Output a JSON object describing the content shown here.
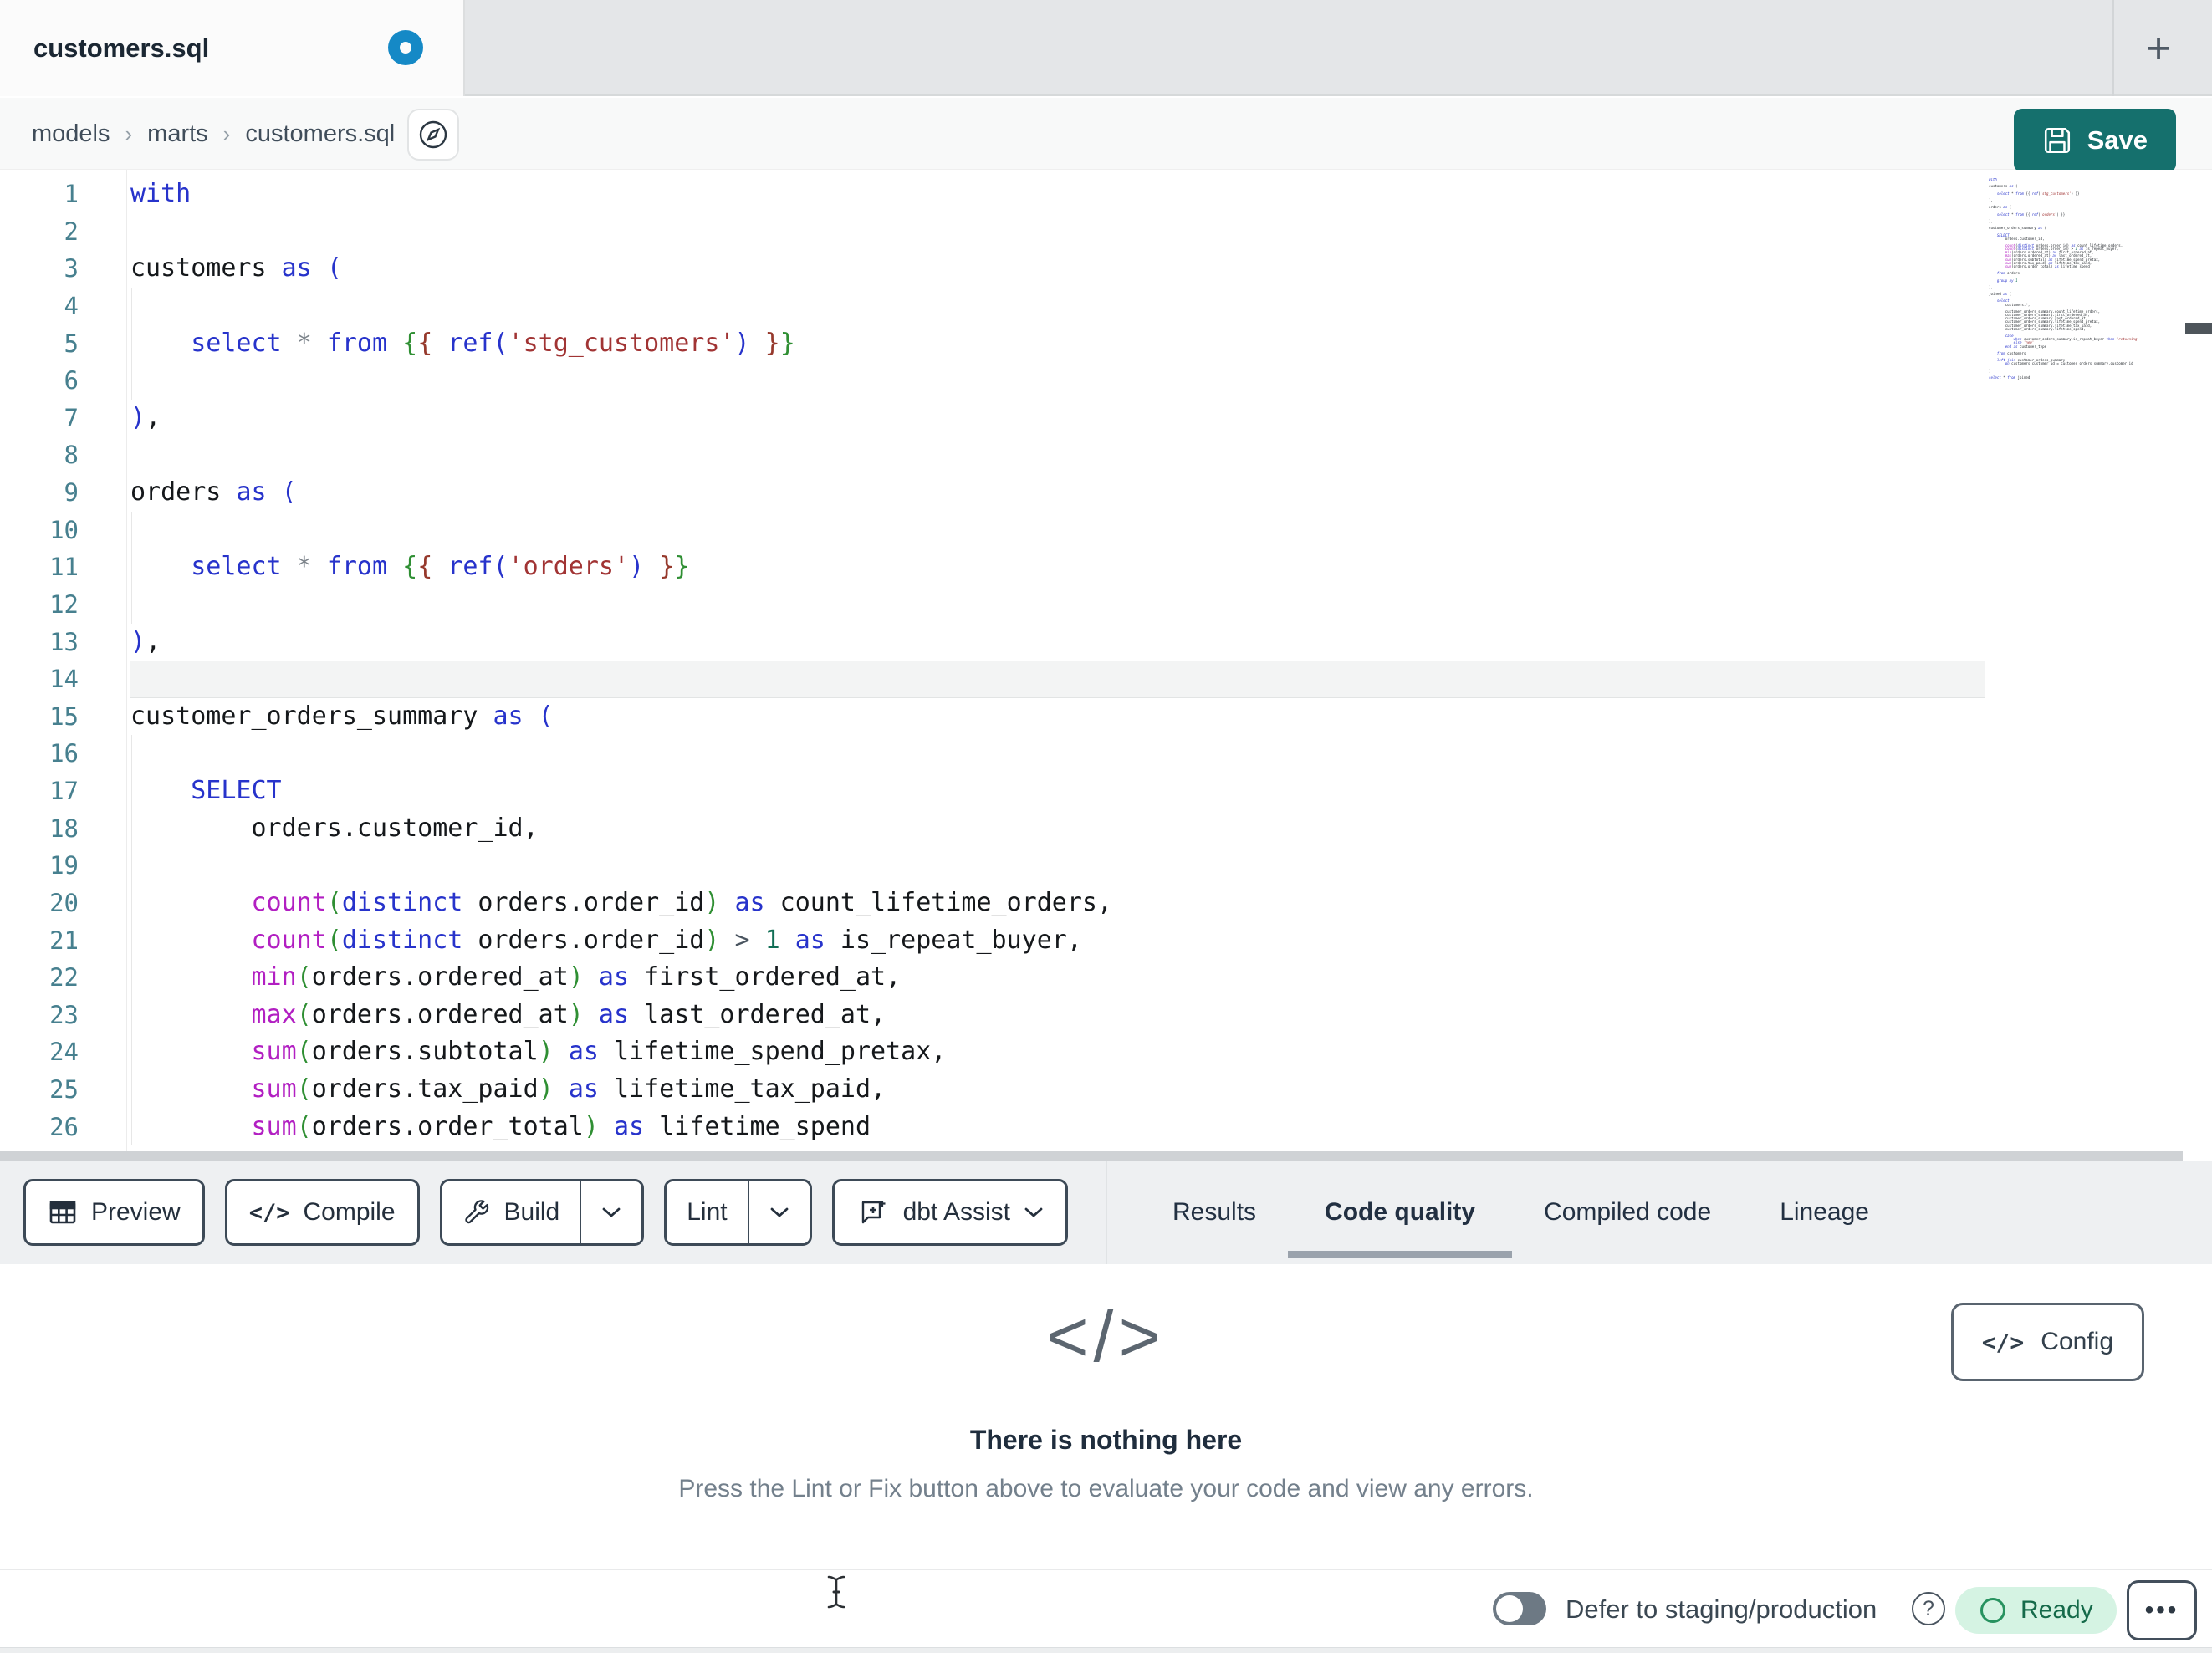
{
  "colors": {
    "accent_teal": "#15706d",
    "unsaved_dot_blue": "#1589c6",
    "ready_badge_bg": "#d5f3e3",
    "ready_badge_text": "#156a4a",
    "syntax_keyword": "#2733cb",
    "syntax_function": "#b21fc2",
    "syntax_string": "#a13434",
    "syntax_number": "#116e55",
    "line_number": "#47808f"
  },
  "tab_bar": {
    "active_tab": "customers.sql",
    "new_tab": "+"
  },
  "breadcrumb": {
    "items": [
      "models",
      "marts",
      "customers.sql"
    ],
    "separator": "›"
  },
  "save_button": {
    "label": "Save"
  },
  "editor": {
    "active_line": 14,
    "lines": [
      {
        "n": 1,
        "t": [
          [
            "kw",
            "with"
          ]
        ]
      },
      {
        "n": 2,
        "t": []
      },
      {
        "n": 3,
        "t": [
          [
            "d",
            "customers "
          ],
          [
            "kw",
            "as"
          ],
          [
            "d",
            " "
          ],
          [
            "b1",
            "("
          ]
        ]
      },
      {
        "n": 4,
        "t": [],
        "g": [
          0
        ]
      },
      {
        "n": 5,
        "t": [
          [
            "d",
            "    "
          ],
          [
            "kw",
            "select"
          ],
          [
            "d",
            " "
          ],
          [
            "op",
            "*"
          ],
          [
            "d",
            " "
          ],
          [
            "kw",
            "from"
          ],
          [
            "d",
            " "
          ],
          [
            "b2",
            "{"
          ],
          [
            "b3",
            "{"
          ],
          [
            "d",
            " "
          ],
          [
            "kw",
            "ref"
          ],
          [
            "b1",
            "("
          ],
          [
            "str",
            "'stg_customers'"
          ],
          [
            "b1",
            ")"
          ],
          [
            "d",
            " "
          ],
          [
            "b3",
            "}"
          ],
          [
            "b2",
            "}"
          ]
        ],
        "g": [
          0
        ]
      },
      {
        "n": 6,
        "t": [],
        "g": [
          0
        ]
      },
      {
        "n": 7,
        "t": [
          [
            "b1",
            ")"
          ],
          [
            "d",
            ","
          ]
        ]
      },
      {
        "n": 8,
        "t": []
      },
      {
        "n": 9,
        "t": [
          [
            "d",
            "orders "
          ],
          [
            "kw",
            "as"
          ],
          [
            "d",
            " "
          ],
          [
            "b1",
            "("
          ]
        ]
      },
      {
        "n": 10,
        "t": [],
        "g": [
          0
        ]
      },
      {
        "n": 11,
        "t": [
          [
            "d",
            "    "
          ],
          [
            "kw",
            "select"
          ],
          [
            "d",
            " "
          ],
          [
            "op",
            "*"
          ],
          [
            "d",
            " "
          ],
          [
            "kw",
            "from"
          ],
          [
            "d",
            " "
          ],
          [
            "b2",
            "{"
          ],
          [
            "b3",
            "{"
          ],
          [
            "d",
            " "
          ],
          [
            "kw",
            "ref"
          ],
          [
            "b1",
            "("
          ],
          [
            "str",
            "'orders'"
          ],
          [
            "b1",
            ")"
          ],
          [
            "d",
            " "
          ],
          [
            "b3",
            "}"
          ],
          [
            "b2",
            "}"
          ]
        ],
        "g": [
          0
        ]
      },
      {
        "n": 12,
        "t": [],
        "g": [
          0
        ]
      },
      {
        "n": 13,
        "t": [
          [
            "b1",
            ")"
          ],
          [
            "d",
            ","
          ]
        ]
      },
      {
        "n": 14,
        "t": []
      },
      {
        "n": 15,
        "t": [
          [
            "d",
            "customer_orders_summary "
          ],
          [
            "kw",
            "as"
          ],
          [
            "d",
            " "
          ],
          [
            "b1",
            "("
          ]
        ]
      },
      {
        "n": 16,
        "t": [],
        "g": [
          0
        ]
      },
      {
        "n": 17,
        "t": [
          [
            "d",
            "    "
          ],
          [
            "kw",
            "SELECT"
          ]
        ],
        "g": [
          0
        ]
      },
      {
        "n": 18,
        "t": [
          [
            "d",
            "        orders.customer_id,"
          ]
        ],
        "g": [
          0,
          4
        ]
      },
      {
        "n": 19,
        "t": [],
        "g": [
          0,
          4
        ]
      },
      {
        "n": 20,
        "t": [
          [
            "d",
            "        "
          ],
          [
            "fn",
            "count"
          ],
          [
            "b2",
            "("
          ],
          [
            "kw",
            "distinct"
          ],
          [
            "d",
            " orders.order_id"
          ],
          [
            "b2",
            ")"
          ],
          [
            "d",
            " "
          ],
          [
            "kw",
            "as"
          ],
          [
            "d",
            " count_lifetime_orders,"
          ]
        ],
        "g": [
          0,
          4
        ]
      },
      {
        "n": 21,
        "t": [
          [
            "d",
            "        "
          ],
          [
            "fn",
            "count"
          ],
          [
            "b2",
            "("
          ],
          [
            "kw",
            "distinct"
          ],
          [
            "d",
            " orders.order_id"
          ],
          [
            "b2",
            ")"
          ],
          [
            "d",
            " "
          ],
          [
            "o2",
            ">"
          ],
          [
            "d",
            " "
          ],
          [
            "num",
            "1"
          ],
          [
            "d",
            " "
          ],
          [
            "kw",
            "as"
          ],
          [
            "d",
            " is_repeat_buyer,"
          ]
        ],
        "g": [
          0,
          4
        ]
      },
      {
        "n": 22,
        "t": [
          [
            "d",
            "        "
          ],
          [
            "fn",
            "min"
          ],
          [
            "b2",
            "("
          ],
          [
            "d",
            "orders.ordered_at"
          ],
          [
            "b2",
            ")"
          ],
          [
            "d",
            " "
          ],
          [
            "kw",
            "as"
          ],
          [
            "d",
            " first_ordered_at,"
          ]
        ],
        "g": [
          0,
          4
        ]
      },
      {
        "n": 23,
        "t": [
          [
            "d",
            "        "
          ],
          [
            "fn",
            "max"
          ],
          [
            "b2",
            "("
          ],
          [
            "d",
            "orders.ordered_at"
          ],
          [
            "b2",
            ")"
          ],
          [
            "d",
            " "
          ],
          [
            "kw",
            "as"
          ],
          [
            "d",
            " last_ordered_at,"
          ]
        ],
        "g": [
          0,
          4
        ]
      },
      {
        "n": 24,
        "t": [
          [
            "d",
            "        "
          ],
          [
            "fn",
            "sum"
          ],
          [
            "b2",
            "("
          ],
          [
            "d",
            "orders.subtotal"
          ],
          [
            "b2",
            ")"
          ],
          [
            "d",
            " "
          ],
          [
            "kw",
            "as"
          ],
          [
            "d",
            " lifetime_spend_pretax,"
          ]
        ],
        "g": [
          0,
          4
        ]
      },
      {
        "n": 25,
        "t": [
          [
            "d",
            "        "
          ],
          [
            "fn",
            "sum"
          ],
          [
            "b2",
            "("
          ],
          [
            "d",
            "orders.tax_paid"
          ],
          [
            "b2",
            ")"
          ],
          [
            "d",
            " "
          ],
          [
            "kw",
            "as"
          ],
          [
            "d",
            " lifetime_tax_paid,"
          ]
        ],
        "g": [
          0,
          4
        ]
      },
      {
        "n": 26,
        "t": [
          [
            "d",
            "        "
          ],
          [
            "fn",
            "sum"
          ],
          [
            "b2",
            "("
          ],
          [
            "d",
            "orders.order_total"
          ],
          [
            "b2",
            ")"
          ],
          [
            "d",
            " "
          ],
          [
            "kw",
            "as"
          ],
          [
            "d",
            " lifetime_spend"
          ]
        ],
        "g": [
          0,
          4
        ]
      }
    ]
  },
  "minimap": {
    "lines": [
      "with",
      "",
      "customers as (",
      "",
      "    select * from {{ ref('stg_customers') }}",
      "",
      "),",
      "",
      "orders as (",
      "",
      "    select * from {{ ref('orders') }}",
      "",
      "),",
      "",
      "customer_orders_summary as (",
      "",
      "    SELECT",
      "        orders.customer_id,",
      "",
      "        count(distinct orders.order_id) as count_lifetime_orders,",
      "        count(distinct orders.order_id) > 1 as is_repeat_buyer,",
      "        min(orders.ordered_at) as first_ordered_at,",
      "        max(orders.ordered_at) as last_ordered_at,",
      "        sum(orders.subtotal) as lifetime_spend_pretax,",
      "        sum(orders.tax_paid) as lifetime_tax_paid,",
      "        sum(orders.order_total) as lifetime_spend",
      "",
      "    from orders",
      "",
      "    group by 1",
      "",
      "),",
      "",
      "joined as (",
      "",
      "    select",
      "        customers.*,",
      "",
      "        customer_orders_summary.count_lifetime_orders,",
      "        customer_orders_summary.first_ordered_at,",
      "        customer_orders_summary.last_ordered_at,",
      "        customer_orders_summary.lifetime_spend_pretax,",
      "        customer_orders_summary.lifetime_tax_paid,",
      "        customer_orders_summary.lifetime_spend,",
      "",
      "        case",
      "            when customer_orders_summary.is_repeat_buyer then 'returning'",
      "            else 'new'",
      "        end as customer_type",
      "",
      "    from customers",
      "",
      "    left join customer_orders_summary",
      "        on customers.customer_id = customer_orders_summary.customer_id",
      "",
      ")",
      "",
      "select * from joined"
    ]
  },
  "toolbar": {
    "preview": "Preview",
    "compile": "Compile",
    "build": "Build",
    "lint": "Lint",
    "assist": "dbt Assist"
  },
  "panel_tabs": {
    "tabs": [
      "Results",
      "Code quality",
      "Compiled code",
      "Lineage"
    ],
    "active": "Code quality"
  },
  "results_panel": {
    "heading": "There is nothing here",
    "subtext": "Press the Lint or Fix button above to evaluate your code and view any errors.",
    "empty_icon": "</>",
    "config": "Config",
    "config_icon": "</>"
  },
  "status_bar": {
    "defer_label": "Defer to staging/production",
    "ready": "Ready",
    "more": "•••"
  }
}
